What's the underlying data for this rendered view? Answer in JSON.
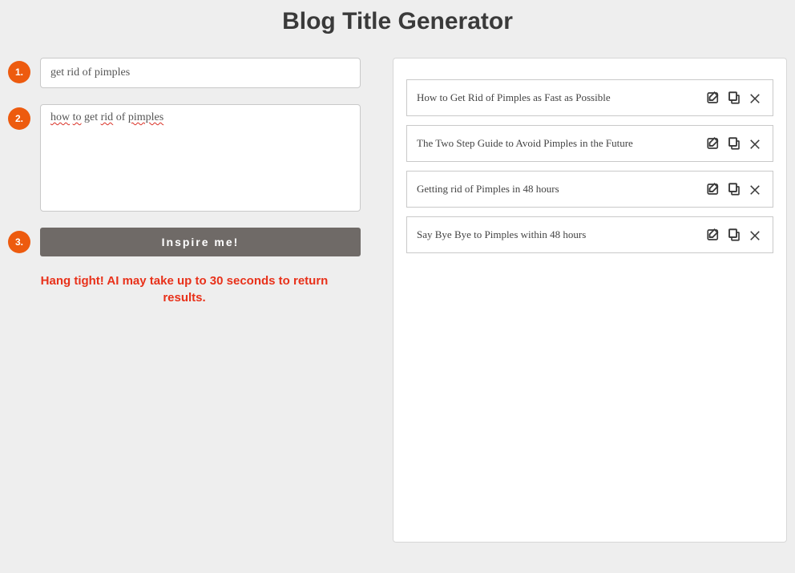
{
  "page": {
    "title": "Blog Title Generator"
  },
  "steps": {
    "1": {
      "badge": "1.",
      "value": "get rid of pimples"
    },
    "2": {
      "badge": "2.",
      "value_plain": "how to get rid of pimples",
      "words": [
        "how",
        "to",
        "get",
        "rid",
        "of",
        "pimples"
      ],
      "squiggle_idx": [
        0,
        1,
        3,
        5
      ]
    },
    "3": {
      "badge": "3.",
      "button_label": "Inspire me!"
    }
  },
  "status": "Hang tight! AI may take up to 30 seconds to return results.",
  "results": [
    {
      "text": "How to Get Rid of Pimples as Fast as Possible"
    },
    {
      "text": "The Two Step Guide to Avoid Pimples in the Future"
    },
    {
      "text": "Getting rid of Pimples in 48 hours"
    },
    {
      "text": "Say Bye Bye to Pimples within 48 hours"
    }
  ],
  "icons": {
    "edit": "edit-icon",
    "copy": "copy-icon",
    "close": "close-icon"
  }
}
